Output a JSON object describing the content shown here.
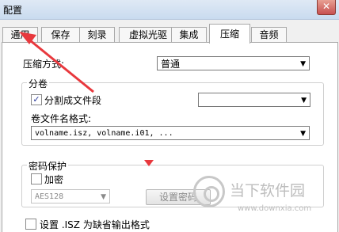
{
  "window": {
    "title": "配置",
    "close_glyph": "✕"
  },
  "tabs": [
    {
      "label": "通用",
      "active": false
    },
    {
      "label": "保存",
      "active": false
    },
    {
      "label": "刻录",
      "active": false
    },
    {
      "label": "虚拟光驱",
      "active": false
    },
    {
      "label": "集成",
      "active": false
    },
    {
      "label": "压缩",
      "active": true
    },
    {
      "label": "音频",
      "active": false
    }
  ],
  "compression": {
    "method_label": "压缩方式:",
    "method_value": "普通"
  },
  "split": {
    "group_title": "分卷",
    "split_label": "分割成文件段",
    "split_checked": true,
    "split_size_value": "",
    "name_format_label": "卷文件名格式:",
    "name_format_value": "volname.isz, volname.i01, ..."
  },
  "password": {
    "group_title": "密码保护",
    "encrypt_label": "加密",
    "encrypt_checked": false,
    "algorithm_value": "AES128",
    "set_password_label": "设置密码"
  },
  "default_format": {
    "label": "设置 .ISZ 为缺省输出格式",
    "checked": false
  },
  "annotation": {
    "arrow_color": "#e8383d"
  },
  "watermark": {
    "cn": "当下软件园",
    "url": "www.downxia.com"
  }
}
